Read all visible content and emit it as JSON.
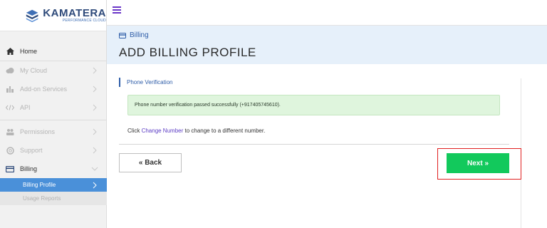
{
  "brand": {
    "name": "KAMATERA",
    "tagline": "PERFORMANCE CLOUD",
    "accent": "#2e4a7a"
  },
  "topbar": {
    "menu_icon": "hamburger-icon",
    "menu_color": "#6a35c8"
  },
  "sidebar": {
    "items": [
      {
        "label": "Home",
        "icon": "home-icon",
        "disabled": false
      },
      {
        "label": "My Cloud",
        "icon": "cloud-icon",
        "disabled": true
      },
      {
        "label": "Add-on Services",
        "icon": "tools-icon",
        "disabled": true
      },
      {
        "label": "API",
        "icon": "code-icon",
        "disabled": true
      },
      {
        "label": "Permissions",
        "icon": "users-icon",
        "disabled": true
      },
      {
        "label": "Support",
        "icon": "support-icon",
        "disabled": true
      },
      {
        "label": "Billing",
        "icon": "credit-card-icon",
        "disabled": false,
        "expanded": true
      }
    ],
    "subitems": [
      {
        "label": "Billing Profile",
        "active": true
      },
      {
        "label": "Usage Reports",
        "active": false
      }
    ],
    "active_color": "#4a90d9"
  },
  "header": {
    "breadcrumb": "Billing",
    "title": "ADD BILLING PROFILE"
  },
  "main": {
    "section_label": "Phone Verification",
    "success_message": "Phone number verification passed successfully (+917405745610).",
    "info_prefix": "Click ",
    "info_link": "Change Number",
    "info_suffix": " to change to a different number.",
    "back_label": "« Back",
    "next_label": "Next »",
    "next_color": "#12c95c",
    "highlight_color": "#e02020"
  }
}
